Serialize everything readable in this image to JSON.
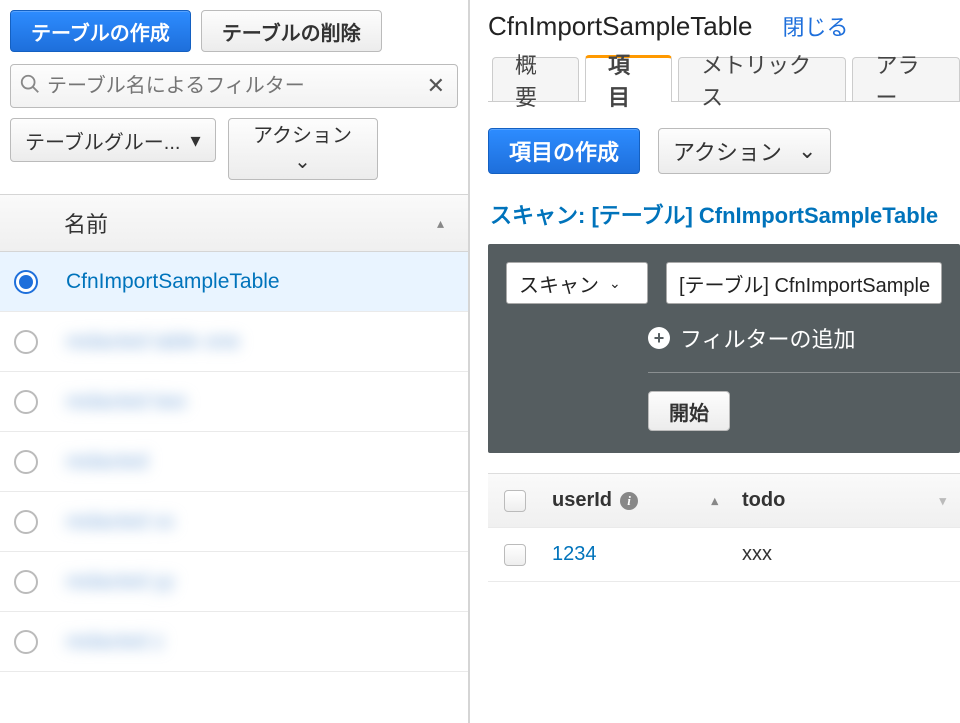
{
  "left": {
    "create_label": "テーブルの作成",
    "delete_label": "テーブルの削除",
    "search_placeholder": "テーブル名によるフィルター",
    "group_dropdown": "テーブルグルー...",
    "action_label": "アクション",
    "column_name": "名前",
    "rows": [
      {
        "name": "CfnImportSampleTable",
        "selected": true,
        "blur": false
      },
      {
        "name": "redacted table one",
        "selected": false,
        "blur": true
      },
      {
        "name": "redacted two",
        "selected": false,
        "blur": true
      },
      {
        "name": "redacted",
        "selected": false,
        "blur": true
      },
      {
        "name": "redacted xx",
        "selected": false,
        "blur": true
      },
      {
        "name": "redacted yy",
        "selected": false,
        "blur": true
      },
      {
        "name": "redacted z",
        "selected": false,
        "blur": true
      }
    ]
  },
  "right": {
    "title": "CfnImportSampleTable",
    "close": "閉じる",
    "tabs": [
      "概要",
      "項目",
      "メトリックス",
      "アラー"
    ],
    "active_tab_index": 1,
    "create_item": "項目の作成",
    "action_label": "アクション",
    "scan_label": "スキャン: [テーブル] CfnImportSampleTable",
    "query": {
      "mode": "スキャン",
      "target": "[テーブル] CfnImportSample",
      "add_filter": "フィルターの追加",
      "start": "開始"
    },
    "results": {
      "columns": [
        "userId",
        "todo"
      ],
      "rows": [
        {
          "userId": "1234",
          "todo": "xxx"
        }
      ]
    }
  }
}
